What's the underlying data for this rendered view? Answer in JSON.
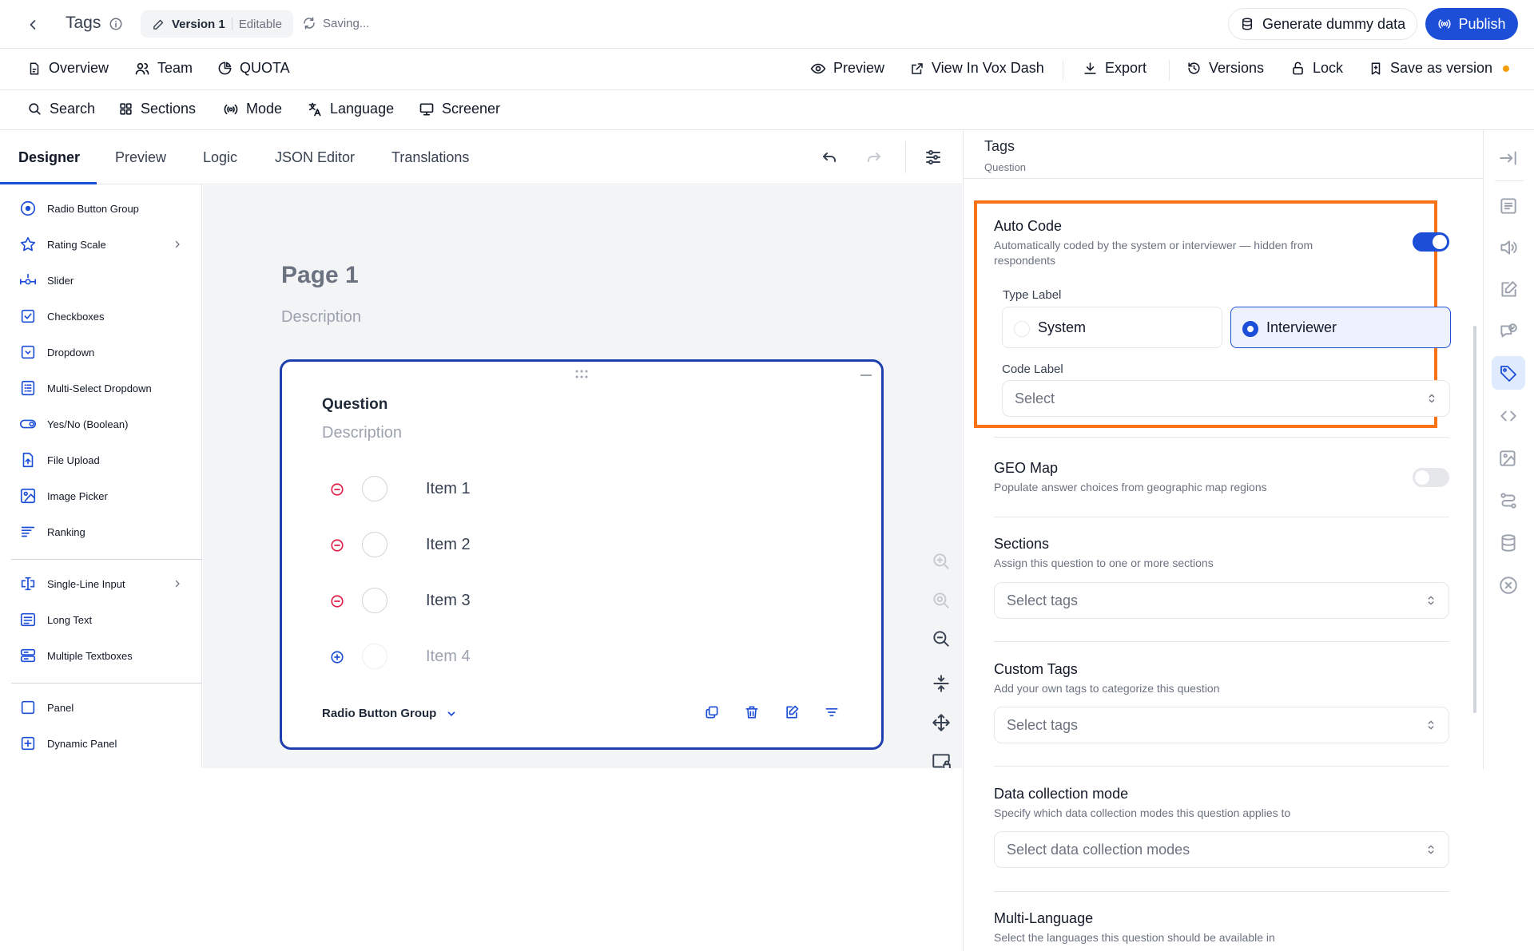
{
  "header": {
    "title": "Tags",
    "version_name": "Version 1",
    "version_state": "Editable",
    "saving_text": "Saving...",
    "generate_label": "Generate dummy data",
    "publish_label": "Publish"
  },
  "menu": {
    "overview": "Overview",
    "team": "Team",
    "quota": "QUOTA",
    "preview": "Preview",
    "view_vox": "View In Vox Dash",
    "export": "Export",
    "versions": "Versions",
    "lock": "Lock",
    "save_version": "Save as version"
  },
  "toolbar": {
    "search": "Search",
    "sections": "Sections",
    "mode": "Mode",
    "language": "Language",
    "screener": "Screener"
  },
  "tabs": [
    "Designer",
    "Preview",
    "Logic",
    "JSON Editor",
    "Translations"
  ],
  "toolbox": {
    "items": [
      {
        "label": "Radio Button Group",
        "icon": "radio-icon"
      },
      {
        "label": "Rating Scale",
        "icon": "star-icon"
      },
      {
        "label": "Slider",
        "icon": "slider-icon"
      },
      {
        "label": "Checkboxes",
        "icon": "checkbox-icon"
      },
      {
        "label": "Dropdown",
        "icon": "dropdown-icon"
      },
      {
        "label": "Multi-Select Dropdown",
        "icon": "multiselect-icon"
      },
      {
        "label": "Yes/No (Boolean)",
        "icon": "toggle-icon"
      },
      {
        "label": "File Upload",
        "icon": "file-upload-icon"
      },
      {
        "label": "Image Picker",
        "icon": "image-picker-icon"
      },
      {
        "label": "Ranking",
        "icon": "ranking-icon"
      },
      {
        "label": "Single-Line Input",
        "icon": "text-cursor-icon"
      },
      {
        "label": "Long Text",
        "icon": "long-text-icon"
      },
      {
        "label": "Multiple Textboxes",
        "icon": "multiple-textboxes-icon"
      },
      {
        "label": "Panel",
        "icon": "panel-icon"
      },
      {
        "label": "Dynamic Panel",
        "icon": "dynamic-panel-icon"
      }
    ]
  },
  "canvas": {
    "page_title": "Page 1",
    "page_description": "Description",
    "question": {
      "title": "Question",
      "description": "Description",
      "choices": [
        "Item 1",
        "Item 2",
        "Item 3",
        "Item 4"
      ],
      "type_label": "Radio Button Group"
    }
  },
  "panel": {
    "title": "Tags",
    "subtitle": "Question",
    "auto_code": {
      "title": "Auto Code",
      "description": "Automatically coded by the system or interviewer — hidden from respondents",
      "enabled": true,
      "type_label": "Type Label",
      "options": [
        "System",
        "Interviewer"
      ],
      "selected": "Interviewer",
      "code_label": "Code Label",
      "code_placeholder": "Select"
    },
    "geo_map": {
      "title": "GEO Map",
      "description": "Populate answer choices from geographic map regions",
      "enabled": false
    },
    "sections": {
      "title": "Sections",
      "description": "Assign this question to one or more sections",
      "placeholder": "Select tags"
    },
    "custom_tags": {
      "title": "Custom Tags",
      "description": "Add your own tags to categorize this question",
      "placeholder": "Select tags"
    },
    "data_collection": {
      "title": "Data collection mode",
      "description": "Specify which data collection modes this question applies to",
      "placeholder": "Select data collection modes"
    },
    "multi_language": {
      "title": "Multi-Language",
      "description": "Select the languages this question should be available in"
    }
  },
  "colors": {
    "accent": "#1d4ed8",
    "highlight": "#f97316",
    "remove": "#e11d48",
    "unsaved_dot": "#f59e0b"
  }
}
